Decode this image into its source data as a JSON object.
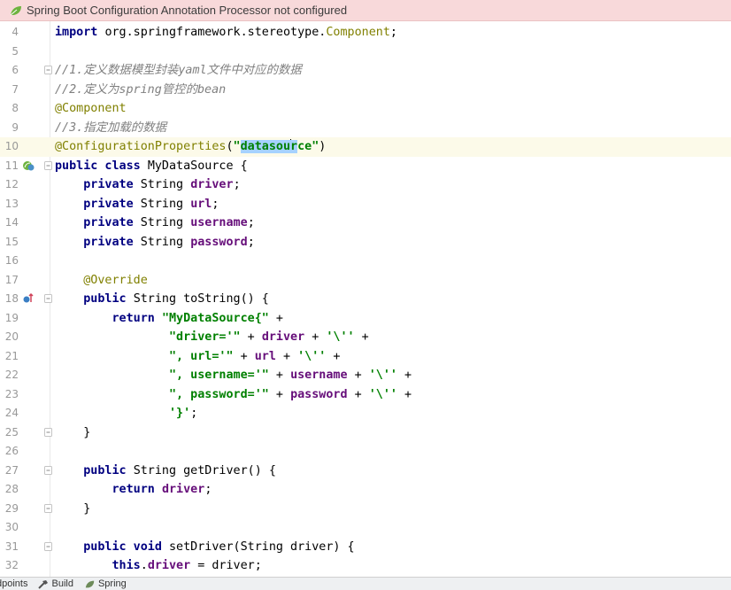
{
  "banner": {
    "icon": "spring-leaf-icon",
    "message": "Spring Boot Configuration Annotation Processor not configured"
  },
  "editor": {
    "lines": [
      {
        "n": "4",
        "tokens": [
          [
            "kw",
            "import "
          ],
          [
            "typ",
            "org.springframework.stereotype."
          ],
          [
            "ann",
            "Component"
          ],
          [
            "typ",
            ";"
          ]
        ]
      },
      {
        "n": "5",
        "tokens": []
      },
      {
        "n": "6",
        "tokens": [
          [
            "cmt",
            "//1.定义数据模型封装yaml文件中对应的数据"
          ]
        ]
      },
      {
        "n": "7",
        "tokens": [
          [
            "cmt",
            "//2.定义为spring管控的bean"
          ]
        ]
      },
      {
        "n": "8",
        "tokens": [
          [
            "ann",
            "@Component"
          ]
        ]
      },
      {
        "n": "9",
        "tokens": [
          [
            "cmt",
            "//3.指定加载的数据"
          ]
        ]
      },
      {
        "n": "10",
        "current": true,
        "tokens": [
          [
            "ann",
            "@ConfigurationProperties"
          ],
          [
            "typ",
            "("
          ],
          [
            "str",
            "\""
          ],
          [
            "hl",
            "datasou"
          ],
          [
            "cursor",
            ""
          ],
          [
            "hl",
            "r"
          ],
          [
            "str",
            "ce\""
          ],
          [
            "typ",
            ")"
          ]
        ]
      },
      {
        "n": "11",
        "tokens": [
          [
            "kw",
            "public class "
          ],
          [
            "typ",
            "MyDataSource {"
          ]
        ]
      },
      {
        "n": "12",
        "tokens": [
          [
            "typ",
            "    "
          ],
          [
            "kw",
            "private "
          ],
          [
            "typ",
            "String "
          ],
          [
            "fld",
            "driver"
          ],
          [
            "typ",
            ";"
          ]
        ]
      },
      {
        "n": "13",
        "tokens": [
          [
            "typ",
            "    "
          ],
          [
            "kw",
            "private "
          ],
          [
            "typ",
            "String "
          ],
          [
            "fld",
            "url"
          ],
          [
            "typ",
            ";"
          ]
        ]
      },
      {
        "n": "14",
        "tokens": [
          [
            "typ",
            "    "
          ],
          [
            "kw",
            "private "
          ],
          [
            "typ",
            "String "
          ],
          [
            "fld",
            "username"
          ],
          [
            "typ",
            ";"
          ]
        ]
      },
      {
        "n": "15",
        "tokens": [
          [
            "typ",
            "    "
          ],
          [
            "kw",
            "private "
          ],
          [
            "typ",
            "String "
          ],
          [
            "fld",
            "password"
          ],
          [
            "typ",
            ";"
          ]
        ]
      },
      {
        "n": "16",
        "tokens": []
      },
      {
        "n": "17",
        "tokens": [
          [
            "typ",
            "    "
          ],
          [
            "ann",
            "@Override"
          ]
        ]
      },
      {
        "n": "18",
        "tokens": [
          [
            "typ",
            "    "
          ],
          [
            "kw",
            "public "
          ],
          [
            "typ",
            "String "
          ],
          [
            "typ",
            "toString() {"
          ]
        ]
      },
      {
        "n": "19",
        "tokens": [
          [
            "typ",
            "        "
          ],
          [
            "kw",
            "return "
          ],
          [
            "str",
            "\"MyDataSource{\""
          ],
          [
            "typ",
            " +"
          ]
        ]
      },
      {
        "n": "20",
        "tokens": [
          [
            "typ",
            "                "
          ],
          [
            "str",
            "\"driver='\""
          ],
          [
            "typ",
            " + "
          ],
          [
            "fld",
            "driver"
          ],
          [
            "typ",
            " + "
          ],
          [
            "str",
            "'\\''"
          ],
          [
            "typ",
            " +"
          ]
        ]
      },
      {
        "n": "21",
        "tokens": [
          [
            "typ",
            "                "
          ],
          [
            "str",
            "\", url='\""
          ],
          [
            "typ",
            " + "
          ],
          [
            "fld",
            "url"
          ],
          [
            "typ",
            " + "
          ],
          [
            "str",
            "'\\''"
          ],
          [
            "typ",
            " +"
          ]
        ]
      },
      {
        "n": "22",
        "tokens": [
          [
            "typ",
            "                "
          ],
          [
            "str",
            "\", username='\""
          ],
          [
            "typ",
            " + "
          ],
          [
            "fld",
            "username"
          ],
          [
            "typ",
            " + "
          ],
          [
            "str",
            "'\\''"
          ],
          [
            "typ",
            " +"
          ]
        ]
      },
      {
        "n": "23",
        "tokens": [
          [
            "typ",
            "                "
          ],
          [
            "str",
            "\", password='\""
          ],
          [
            "typ",
            " + "
          ],
          [
            "fld",
            "password"
          ],
          [
            "typ",
            " + "
          ],
          [
            "str",
            "'\\''"
          ],
          [
            "typ",
            " +"
          ]
        ]
      },
      {
        "n": "24",
        "tokens": [
          [
            "typ",
            "                "
          ],
          [
            "str",
            "'}'"
          ],
          [
            "typ",
            ";"
          ]
        ]
      },
      {
        "n": "25",
        "tokens": [
          [
            "typ",
            "    }"
          ]
        ]
      },
      {
        "n": "26",
        "tokens": []
      },
      {
        "n": "27",
        "tokens": [
          [
            "typ",
            "    "
          ],
          [
            "kw",
            "public "
          ],
          [
            "typ",
            "String getDriver() {"
          ]
        ]
      },
      {
        "n": "28",
        "tokens": [
          [
            "typ",
            "        "
          ],
          [
            "kw",
            "return "
          ],
          [
            "fld",
            "driver"
          ],
          [
            "typ",
            ";"
          ]
        ]
      },
      {
        "n": "29",
        "tokens": [
          [
            "typ",
            "    }"
          ]
        ]
      },
      {
        "n": "30",
        "tokens": []
      },
      {
        "n": "31",
        "tokens": [
          [
            "typ",
            "    "
          ],
          [
            "kw",
            "public void "
          ],
          [
            "typ",
            "setDriver(String driver) {"
          ]
        ]
      },
      {
        "n": "32",
        "tokens": [
          [
            "typ",
            "        "
          ],
          [
            "kw",
            "this"
          ],
          [
            "typ",
            "."
          ],
          [
            "fld",
            "driver"
          ],
          [
            "typ",
            " = driver;"
          ]
        ]
      }
    ],
    "gutter_icons": {
      "11": "spring-bean-icon",
      "18": "override-method-icon"
    },
    "fold_lines": [
      "6",
      "11",
      "18",
      "25",
      "27",
      "29",
      "31"
    ]
  },
  "statusbar": {
    "items": [
      {
        "label": "dpoints",
        "icon": "breakpoints-icon"
      },
      {
        "label": "Build",
        "icon": "hammer-icon"
      },
      {
        "label": "Spring",
        "icon": "spring-leaf-icon"
      }
    ]
  },
  "colors": {
    "banner_bg": "#f8d9da",
    "keyword": "#000080",
    "string": "#008000",
    "comment": "#808080",
    "annotation": "#808000",
    "field": "#660e7a",
    "selection": "#a6d2ff"
  }
}
